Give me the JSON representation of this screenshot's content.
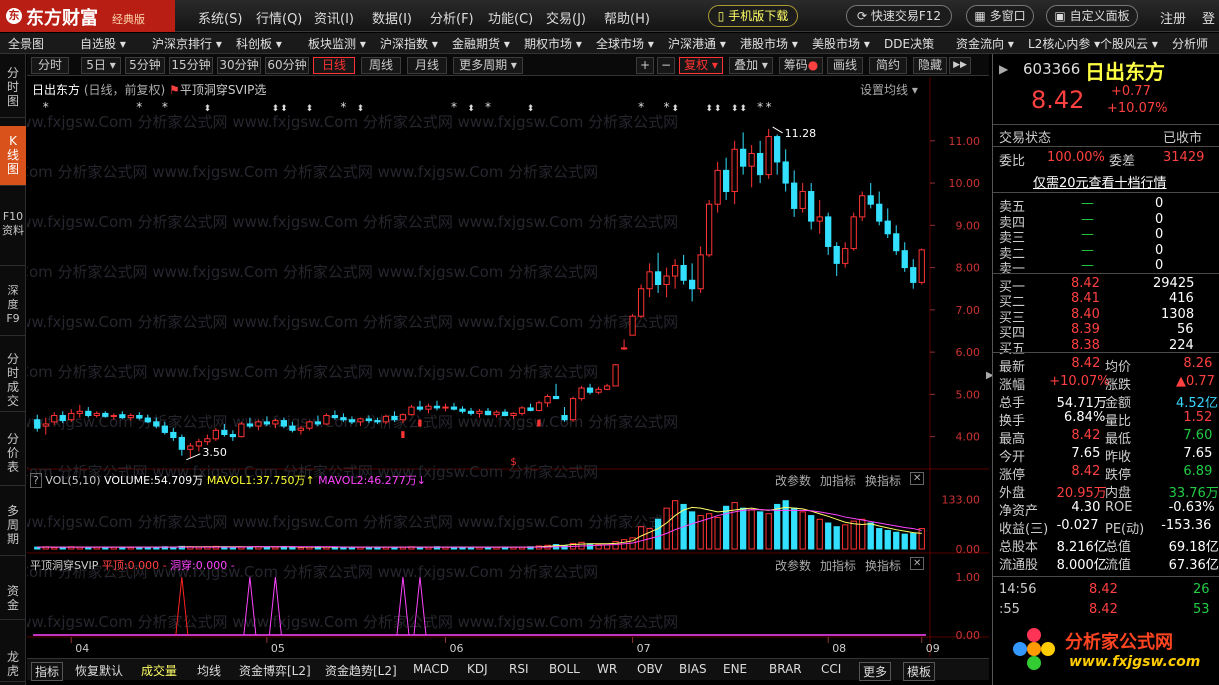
{
  "app": {
    "name": "东方财富",
    "edition": "经典版"
  },
  "menus": [
    "系统(S)",
    "行情(Q)",
    "资讯(I)",
    "数据(I)",
    "分析(F)",
    "功能(C)",
    "交易(J)",
    "帮助(H)"
  ],
  "buttons": {
    "mobile": "手机版下载",
    "quick_trade": "快速交易F12",
    "multi_window": "多窗口",
    "custom_panel": "自定义面板",
    "register": "注册",
    "login": "登"
  },
  "nav": [
    "全景图",
    "自选股 ▾",
    "沪深京排行 ▾",
    "科创板 ▾",
    "板块监测 ▾",
    "沪深指数 ▾",
    "金融期货 ▾",
    "期权市场 ▾",
    "全球市场 ▾",
    "沪深港通 ▾",
    "港股市场 ▾",
    "美股市场 ▾",
    "DDE决策",
    "资金流向 ▾",
    "L2核心内参 ▾",
    "个股风云 ▾",
    "分析师"
  ],
  "sidebar": [
    "分时图",
    "K线图",
    "F10资料",
    "深度F9",
    "分时成交",
    "分价表",
    "多周期",
    "资金",
    "龙虎"
  ],
  "periods": [
    "分时",
    "5日 ▾",
    "5分钟",
    "15分钟",
    "30分钟",
    "60分钟",
    "日线",
    "周线",
    "月线",
    "更多周期 ▾"
  ],
  "tools": {
    "plus": "+",
    "minus": "−",
    "fuquan": "复权 ▾",
    "overlay": "叠加 ▾",
    "chip": "筹码",
    "draw": "画线",
    "simple": "简约",
    "hide": "隐藏",
    "expand": "▶▶"
  },
  "chart_header": {
    "stock": "日出东方",
    "mode": "(日线，前复权)",
    "indicator": "平顶洞穿SVIP选",
    "settings": "设置均线 ▾"
  },
  "chart_data": [
    {
      "type": "candlestick",
      "name": "日出东方",
      "x": [
        "04",
        "05",
        "06",
        "07",
        "08",
        "09"
      ],
      "ylim": [
        3.4,
        11.8
      ],
      "y_ticks": [
        "11.00",
        "10.00",
        "9.00",
        "8.00",
        "7.00",
        "6.00",
        "5.00",
        "4.00"
      ],
      "high_label": "11.28",
      "low_label": "3.50",
      "ohlc": [
        [
          4.4,
          4.52,
          4.12,
          4.2
        ],
        [
          4.25,
          4.45,
          4.05,
          4.3
        ],
        [
          4.35,
          4.58,
          4.28,
          4.5
        ],
        [
          4.5,
          4.6,
          4.32,
          4.38
        ],
        [
          4.4,
          4.65,
          4.35,
          4.55
        ],
        [
          4.55,
          4.75,
          4.45,
          4.6
        ],
        [
          4.6,
          4.7,
          4.45,
          4.5
        ],
        [
          4.5,
          4.6,
          4.45,
          4.55
        ],
        [
          4.55,
          4.6,
          4.45,
          4.48
        ],
        [
          4.48,
          4.55,
          4.4,
          4.5
        ],
        [
          4.52,
          4.6,
          4.42,
          4.45
        ],
        [
          4.45,
          4.55,
          4.38,
          4.5
        ],
        [
          4.5,
          4.58,
          4.4,
          4.44
        ],
        [
          4.44,
          4.52,
          4.32,
          4.35
        ],
        [
          4.35,
          4.45,
          4.2,
          4.25
        ],
        [
          4.25,
          4.35,
          4.05,
          4.1
        ],
        [
          4.1,
          4.2,
          3.9,
          3.98
        ],
        [
          3.98,
          4.05,
          3.55,
          3.7
        ],
        [
          3.7,
          3.85,
          3.5,
          3.78
        ],
        [
          3.78,
          3.95,
          3.65,
          3.88
        ],
        [
          3.88,
          4.05,
          3.8,
          3.95
        ],
        [
          3.95,
          4.2,
          3.9,
          4.15
        ],
        [
          4.15,
          4.3,
          4.0,
          4.05
        ],
        [
          4.05,
          4.15,
          3.9,
          4.0
        ],
        [
          4.0,
          4.35,
          3.98,
          4.3
        ],
        [
          4.3,
          4.45,
          4.2,
          4.25
        ],
        [
          4.25,
          4.4,
          4.15,
          4.35
        ],
        [
          4.35,
          4.48,
          4.25,
          4.3
        ],
        [
          4.3,
          4.42,
          4.2,
          4.38
        ],
        [
          4.38,
          4.45,
          4.2,
          4.25
        ],
        [
          4.25,
          4.35,
          4.1,
          4.15
        ],
        [
          4.15,
          4.25,
          4.05,
          4.2
        ],
        [
          4.2,
          4.38,
          4.15,
          4.35
        ],
        [
          4.35,
          4.5,
          4.25,
          4.3
        ],
        [
          4.3,
          4.55,
          4.28,
          4.5
        ],
        [
          4.5,
          4.62,
          4.4,
          4.45
        ],
        [
          4.45,
          4.55,
          4.35,
          4.4
        ],
        [
          4.4,
          4.48,
          4.3,
          4.35
        ],
        [
          4.35,
          4.45,
          4.25,
          4.42
        ],
        [
          4.42,
          4.5,
          4.32,
          4.38
        ],
        [
          4.38,
          4.45,
          4.3,
          4.35
        ],
        [
          4.35,
          4.52,
          4.3,
          4.48
        ],
        [
          4.48,
          4.6,
          4.35,
          4.4
        ],
        [
          4.4,
          4.55,
          4.32,
          4.52
        ],
        [
          4.52,
          4.75,
          4.5,
          4.7
        ],
        [
          4.7,
          4.85,
          4.6,
          4.65
        ],
        [
          4.65,
          4.78,
          4.55,
          4.72
        ],
        [
          4.72,
          4.85,
          4.62,
          4.68
        ],
        [
          4.68,
          4.78,
          4.6,
          4.7
        ],
        [
          4.7,
          4.8,
          4.62,
          4.65
        ],
        [
          4.65,
          4.72,
          4.55,
          4.6
        ],
        [
          4.6,
          4.68,
          4.5,
          4.55
        ],
        [
          4.55,
          4.65,
          4.45,
          4.6
        ],
        [
          4.6,
          4.68,
          4.5,
          4.52
        ],
        [
          4.52,
          4.62,
          4.45,
          4.58
        ],
        [
          4.58,
          4.65,
          4.48,
          4.5
        ],
        [
          4.5,
          4.58,
          4.42,
          4.55
        ],
        [
          4.55,
          4.72,
          4.5,
          4.68
        ],
        [
          4.68,
          4.78,
          4.6,
          4.62
        ],
        [
          4.62,
          4.85,
          4.6,
          4.8
        ],
        [
          4.8,
          5.0,
          4.7,
          4.95
        ],
        [
          4.95,
          5.25,
          4.9,
          4.9
        ],
        [
          4.5,
          4.7,
          4.35,
          4.4
        ],
        [
          4.4,
          4.95,
          4.35,
          4.9
        ],
        [
          4.9,
          5.2,
          4.85,
          5.15
        ],
        [
          5.15,
          5.25,
          5.0,
          5.05
        ],
        [
          5.05,
          5.18,
          5.0,
          5.12
        ],
        [
          5.12,
          5.25,
          5.1,
          5.2
        ],
        [
          5.2,
          5.72,
          5.2,
          5.7
        ],
        [
          6.1,
          6.3,
          6.05,
          6.1
        ],
        [
          6.4,
          6.9,
          6.4,
          6.85
        ],
        [
          6.85,
          7.6,
          6.8,
          7.5
        ],
        [
          7.5,
          8.1,
          7.3,
          7.9
        ],
        [
          7.9,
          8.35,
          7.4,
          7.6
        ],
        [
          7.6,
          8.0,
          7.3,
          7.8
        ],
        [
          7.8,
          8.2,
          7.5,
          8.05
        ],
        [
          8.05,
          8.3,
          7.6,
          7.7
        ],
        [
          7.7,
          8.1,
          7.2,
          7.5
        ],
        [
          7.5,
          8.5,
          7.4,
          8.3
        ],
        [
          8.3,
          9.6,
          8.25,
          9.5
        ],
        [
          9.5,
          10.5,
          9.3,
          10.3
        ],
        [
          10.3,
          10.6,
          9.6,
          9.8
        ],
        [
          9.8,
          11.0,
          9.5,
          10.8
        ],
        [
          10.8,
          11.2,
          10.2,
          10.4
        ],
        [
          10.4,
          10.9,
          9.9,
          10.7
        ],
        [
          10.7,
          11.0,
          10.0,
          10.2
        ],
        [
          10.2,
          11.28,
          10.1,
          11.1
        ],
        [
          11.1,
          11.15,
          10.2,
          10.5
        ],
        [
          10.5,
          10.8,
          9.8,
          10.0
        ],
        [
          10.0,
          10.3,
          9.2,
          9.4
        ],
        [
          9.4,
          10.0,
          9.3,
          9.8
        ],
        [
          9.8,
          10.0,
          8.9,
          9.1
        ],
        [
          9.1,
          9.6,
          8.8,
          9.2
        ],
        [
          9.2,
          9.3,
          8.3,
          8.5
        ],
        [
          8.5,
          8.6,
          7.8,
          8.1
        ],
        [
          8.1,
          8.6,
          8.0,
          8.45
        ],
        [
          8.45,
          9.3,
          8.4,
          9.2
        ],
        [
          9.2,
          9.8,
          9.1,
          9.7
        ],
        [
          9.7,
          10.0,
          9.4,
          9.5
        ],
        [
          9.5,
          9.8,
          9.0,
          9.1
        ],
        [
          9.1,
          9.4,
          8.7,
          8.8
        ],
        [
          8.8,
          9.0,
          8.3,
          8.4
        ],
        [
          8.4,
          8.6,
          7.9,
          8.0
        ],
        [
          8.0,
          8.2,
          7.5,
          7.65
        ],
        [
          7.65,
          8.45,
          7.6,
          8.42
        ]
      ]
    },
    {
      "type": "bar",
      "name": "VOL(5,10)",
      "legend": {
        "volume": "VOLUME:54.709万",
        "ma1": "MAVOL1:37.750万",
        "ma2": "MAVOL2:46.277万"
      },
      "y_ticks": [
        "133.00",
        "0.00"
      ],
      "ylim": [
        0,
        140
      ],
      "values": [
        5,
        6,
        4,
        5,
        6,
        5,
        4,
        5,
        4,
        5,
        4,
        4,
        5,
        4,
        5,
        6,
        5,
        7,
        6,
        5,
        6,
        7,
        6,
        5,
        6,
        5,
        6,
        5,
        5,
        6,
        5,
        4,
        5,
        6,
        5,
        4,
        5,
        4,
        5,
        4,
        5,
        5,
        4,
        5,
        6,
        5,
        5,
        6,
        5,
        4,
        5,
        4,
        5,
        4,
        5,
        4,
        5,
        5,
        6,
        8,
        10,
        12,
        9,
        15,
        18,
        14,
        12,
        11,
        20,
        25,
        30,
        60,
        55,
        80,
        110,
        130,
        120,
        100,
        90,
        95,
        85,
        115,
        125,
        110,
        105,
        100,
        95,
        120,
        130,
        110,
        100,
        90,
        80,
        70,
        60,
        65,
        75,
        80,
        70,
        55,
        50,
        45,
        40,
        42,
        55
      ],
      "ma1": [
        5,
        5,
        5,
        5,
        5,
        5,
        5,
        5,
        5,
        5,
        5,
        5,
        5,
        5,
        5,
        5,
        5,
        6,
        6,
        6,
        6,
        6,
        6,
        6,
        6,
        6,
        6,
        6,
        6,
        6,
        6,
        5,
        5,
        5,
        5,
        5,
        5,
        5,
        5,
        5,
        5,
        5,
        5,
        5,
        5,
        5,
        5,
        5,
        5,
        5,
        5,
        5,
        5,
        5,
        5,
        5,
        5,
        5,
        5,
        6,
        7,
        9,
        10,
        12,
        13,
        14,
        14,
        14,
        15,
        18,
        22,
        35,
        45,
        55,
        70,
        90,
        105,
        112,
        110,
        105,
        100,
        102,
        105,
        108,
        110,
        106,
        104,
        108,
        112,
        110,
        108,
        102,
        95,
        88,
        80,
        72,
        68,
        66,
        68,
        62,
        57,
        52,
        48,
        44,
        42
      ],
      "ma2": [
        5,
        5,
        5,
        5,
        5,
        5,
        5,
        5,
        5,
        5,
        5,
        5,
        5,
        5,
        5,
        5,
        5,
        5,
        5,
        5,
        5,
        5,
        5,
        5,
        5,
        6,
        6,
        6,
        6,
        6,
        6,
        6,
        6,
        6,
        6,
        6,
        5,
        5,
        5,
        5,
        5,
        5,
        5,
        5,
        5,
        5,
        5,
        5,
        5,
        5,
        5,
        5,
        5,
        5,
        5,
        5,
        5,
        5,
        5,
        5,
        5,
        6,
        6,
        7,
        8,
        9,
        10,
        11,
        12,
        14,
        16,
        22,
        28,
        34,
        42,
        52,
        60,
        68,
        75,
        82,
        90,
        95,
        100,
        104,
        106,
        106,
        105,
        104,
        104,
        104,
        104,
        103,
        100,
        96,
        92,
        86,
        82,
        78,
        74,
        70,
        66,
        62,
        58,
        55,
        50
      ]
    },
    {
      "type": "line",
      "name": "平顶洞穿SVIP",
      "legend": {
        "pingding": "平顶:0.000",
        "dongchuan": "洞穿:0.000"
      },
      "y_ticks": [
        "1.00",
        "0.00"
      ],
      "ylim": [
        0,
        1
      ],
      "pingding_index": [
        17
      ],
      "dongchuan_index": [
        25,
        28,
        43,
        45
      ]
    }
  ],
  "vol_tools": {
    "params": "改参数",
    "add": "加指标",
    "switch": "换指标",
    "close": "✕"
  },
  "x_labels": [
    "04",
    "05",
    "06",
    "07",
    "08",
    "09"
  ],
  "quote": {
    "code": "603366",
    "name": "日出东方",
    "price": "8.42",
    "change": "+0.77",
    "pct": "+10.07%",
    "status_label": "交易状态",
    "status": "已收市",
    "weibi_label": "委比",
    "weibi": "100.00%",
    "weicha_label": "委差",
    "weicha": "31429",
    "ten_level": "仅需20元查看十档行情",
    "asks": [
      {
        "label": "卖五",
        "price": "—",
        "vol": "0"
      },
      {
        "label": "卖四",
        "price": "—",
        "vol": "0"
      },
      {
        "label": "卖三",
        "price": "—",
        "vol": "0"
      },
      {
        "label": "卖二",
        "price": "—",
        "vol": "0"
      },
      {
        "label": "卖一",
        "price": "—",
        "vol": "0"
      }
    ],
    "bids": [
      {
        "label": "买一",
        "price": "8.42",
        "vol": "29425"
      },
      {
        "label": "买二",
        "price": "8.41",
        "vol": "416"
      },
      {
        "label": "买三",
        "price": "8.40",
        "vol": "1308"
      },
      {
        "label": "买四",
        "price": "8.39",
        "vol": "56"
      },
      {
        "label": "买五",
        "price": "8.38",
        "vol": "224"
      }
    ],
    "stats": [
      [
        {
          "l": "最新",
          "v": "8.42",
          "c": "red"
        },
        {
          "l": "均价",
          "v": "8.26",
          "c": "red"
        }
      ],
      [
        {
          "l": "涨幅",
          "v": "+10.07%",
          "c": "red"
        },
        {
          "l": "涨跌",
          "v": "▲0.77",
          "c": "red"
        }
      ],
      [
        {
          "l": "总手",
          "v": "54.71万",
          "c": "wht"
        },
        {
          "l": "金额",
          "v": "4.52亿",
          "c": "cyn"
        }
      ],
      [
        {
          "l": "换手",
          "v": "6.84%",
          "c": "wht"
        },
        {
          "l": "量比",
          "v": "1.52",
          "c": "red"
        }
      ],
      [
        {
          "l": "最高",
          "v": "8.42",
          "c": "red"
        },
        {
          "l": "最低",
          "v": "7.60",
          "c": "grn"
        }
      ],
      [
        {
          "l": "今开",
          "v": "7.65",
          "c": "wht"
        },
        {
          "l": "昨收",
          "v": "7.65",
          "c": "wht"
        }
      ],
      [
        {
          "l": "涨停",
          "v": "8.42",
          "c": "red"
        },
        {
          "l": "跌停",
          "v": "6.89",
          "c": "grn"
        }
      ],
      [
        {
          "l": "外盘",
          "v": "20.95万",
          "c": "red"
        },
        {
          "l": "内盘",
          "v": "33.76万",
          "c": "grn"
        }
      ],
      [
        {
          "l": "净资产",
          "v": "4.30",
          "c": "wht"
        },
        {
          "l": "ROE",
          "v": "-0.63%",
          "c": "wht"
        }
      ],
      [
        {
          "l": "收益(三)",
          "v": "-0.027",
          "c": "wht"
        },
        {
          "l": "PE(动)",
          "v": "-153.36",
          "c": "wht"
        }
      ],
      [
        {
          "l": "总股本",
          "v": "8.216亿",
          "c": "wht"
        },
        {
          "l": "总值",
          "v": "69.18亿",
          "c": "wht"
        }
      ],
      [
        {
          "l": "流通股",
          "v": "8.000亿",
          "c": "wht"
        },
        {
          "l": "流值",
          "v": "67.36亿",
          "c": "wht"
        }
      ]
    ],
    "ticks": [
      {
        "t": "14:56",
        "p": "8.42",
        "v": "26"
      },
      {
        "t": ":55",
        "p": "8.42",
        "v": "53"
      }
    ]
  },
  "bottom_tabs": [
    "指标",
    "恢复默认",
    "成交量",
    "均线",
    "资金博弈[L2]",
    "资金趋势[L2]",
    "MACD",
    "KDJ",
    "RSI",
    "BOLL",
    "WR",
    "OBV",
    "BIAS",
    "ENE",
    "BRAR",
    "CCI",
    "更多",
    "模板"
  ],
  "watermark": {
    "text": "分析家公式网",
    "url": "www.fxjgsw.com",
    "repeat": "www.fxjgsw.Com 分析家公式网"
  },
  "colors": {
    "up": "#ff3333",
    "down": "#33e0ff",
    "ma1": "#ffff66",
    "ma2": "#ff44ff",
    "bg": "#000000",
    "accent": "#d9521c"
  }
}
